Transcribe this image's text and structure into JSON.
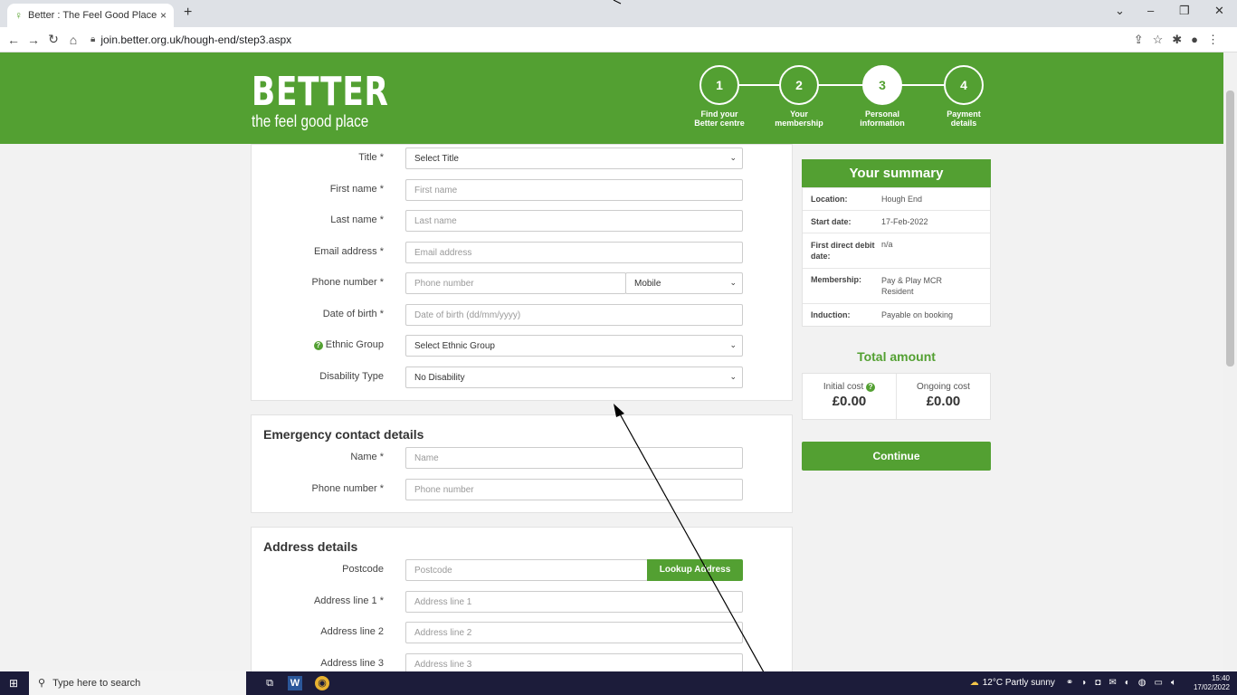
{
  "browser": {
    "tab_title": "Better : The Feel Good Place",
    "tab_close": "×",
    "new_tab": "+",
    "url": "join.better.org.uk/hough-end/step3.aspx"
  },
  "header": {
    "logo_main": "BETTER",
    "logo_sub": "the feel good place",
    "steps": [
      {
        "num": "1",
        "label_1": "Find your",
        "label_2": "Better centre"
      },
      {
        "num": "2",
        "label_1": "Your",
        "label_2": "membership"
      },
      {
        "num": "3",
        "label_1": "Personal",
        "label_2": "information"
      },
      {
        "num": "4",
        "label_1": "Payment",
        "label_2": "details"
      }
    ]
  },
  "personal": {
    "title_label": "Title *",
    "title_value": "Select Title",
    "first_label": "First name *",
    "first_placeholder": "First name",
    "last_label": "Last name *",
    "last_placeholder": "Last name",
    "email_label": "Email address *",
    "email_placeholder": "Email address",
    "phone_label": "Phone number *",
    "phone_placeholder": "Phone number",
    "phone_type": "Mobile",
    "dob_label": "Date of birth *",
    "dob_placeholder": "Date of birth (dd/mm/yyyy)",
    "ethnic_label": "Ethnic Group",
    "ethnic_value": "Select Ethnic Group",
    "disability_label": "Disability Type",
    "disability_value": "No Disability"
  },
  "emergency": {
    "heading": "Emergency contact details",
    "name_label": "Name *",
    "name_placeholder": "Name",
    "phone_label": "Phone number *",
    "phone_placeholder": "Phone number"
  },
  "address": {
    "heading": "Address details",
    "postcode_label": "Postcode",
    "postcode_placeholder": "Postcode",
    "lookup_label": "Lookup Address",
    "line1_label": "Address line 1 *",
    "line1_placeholder": "Address line 1",
    "line2_label": "Address line 2",
    "line2_placeholder": "Address line 2",
    "line3_label": "Address line 3",
    "line3_placeholder": "Address line 3"
  },
  "summary": {
    "heading": "Your summary",
    "rows": [
      {
        "k": "Location:",
        "v": "Hough End"
      },
      {
        "k": "Start date:",
        "v": "17-Feb-2022"
      },
      {
        "k": "First direct debit date:",
        "v": "n/a"
      },
      {
        "k": "Membership:",
        "v": "Pay & Play MCR Resident"
      },
      {
        "k": "Induction:",
        "v": "Payable on booking"
      }
    ],
    "total_heading": "Total amount",
    "initial_label": "Initial cost",
    "initial_value": "£0.00",
    "ongoing_label": "Ongoing cost",
    "ongoing_value": "£0.00",
    "continue_label": "Continue"
  },
  "taskbar": {
    "search_placeholder": "Type here to search",
    "weather": "12°C Partly sunny",
    "time": "15:40",
    "date": "17/02/2022"
  },
  "colors": {
    "brand_green": "#53a032"
  }
}
